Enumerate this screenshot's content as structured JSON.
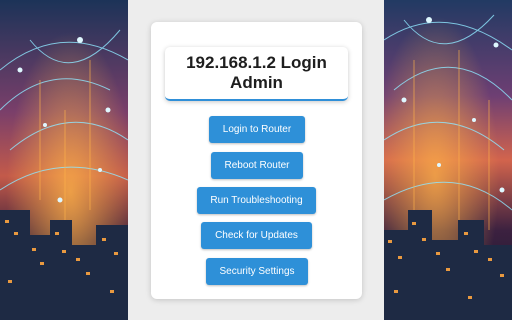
{
  "page": {
    "title_line1": "192.168.1.2 Login",
    "title_line2": "Admin"
  },
  "buttons": {
    "login": "Login to Router",
    "reboot": "Reboot Router",
    "troubleshoot": "Run Troubleshooting",
    "updates": "Check for Updates",
    "security": "Security Settings"
  },
  "colors": {
    "button": "#2e90d8",
    "panel_background": "#ededed",
    "card": "#ffffff",
    "title_underline": "#2f8fd8"
  },
  "images": {
    "left": "network-city-illustration",
    "right": "network-city-illustration"
  }
}
